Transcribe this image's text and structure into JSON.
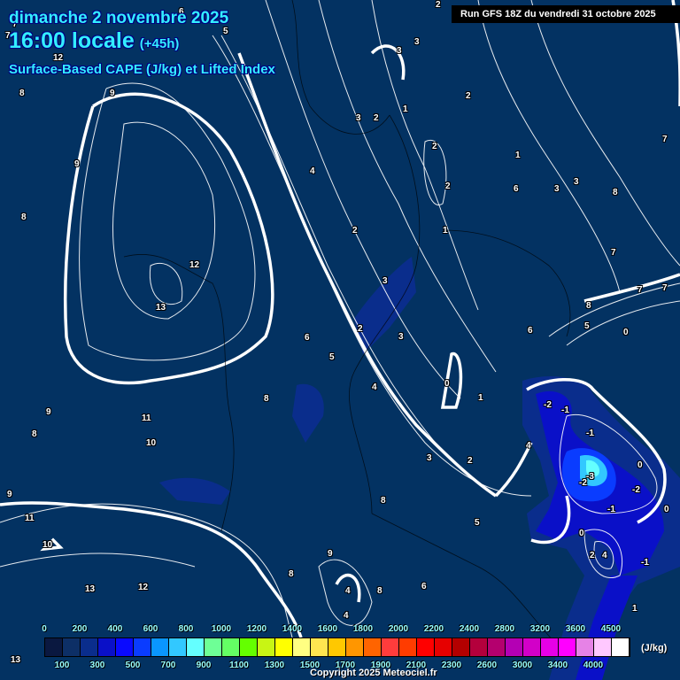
{
  "header": {
    "date": "dimanche 2 novembre 2025",
    "time": "16:00 locale",
    "lead": "(+45h)",
    "title": "Surface-Based CAPE (J/kg) et Lifted Index",
    "run": "Run GFS 18Z du vendredi 31 octobre 2025"
  },
  "legend": {
    "unit": "(J/kg)",
    "top_labels": [
      "0",
      "200",
      "400",
      "600",
      "800",
      "1000",
      "1200",
      "1400",
      "1600",
      "1800",
      "2000",
      "2200",
      "2400",
      "2800",
      "3200",
      "3600",
      "4500"
    ],
    "bottom_labels": [
      "100",
      "300",
      "500",
      "700",
      "900",
      "1100",
      "1300",
      "1500",
      "1700",
      "1900",
      "2100",
      "2300",
      "2600",
      "3000",
      "3400",
      "4000"
    ],
    "colors": [
      "#0a1840",
      "#0d2f66",
      "#0a2d8c",
      "#0a10c8",
      "#0a0aff",
      "#0a3cff",
      "#0a96ff",
      "#32c8ff",
      "#64ffff",
      "#6eff96",
      "#64ff64",
      "#64ff00",
      "#c8f514",
      "#ffff00",
      "#ffff82",
      "#ffe650",
      "#ffc800",
      "#ff9600",
      "#ff6400",
      "#ff3c3c",
      "#ff3c00",
      "#ff0000",
      "#e60000",
      "#b40000",
      "#b4003c",
      "#b4006e",
      "#b400b4",
      "#d200c8",
      "#e600e6",
      "#ff00ff",
      "#e682e6",
      "#ffc8ff",
      "#ffffff"
    ]
  },
  "lifted_index_labels": [
    "7",
    "12",
    "8",
    "9",
    "9",
    "8",
    "12",
    "13",
    "9",
    "8",
    "11",
    "10",
    "9",
    "8",
    "11",
    "10",
    "13",
    "12",
    "6",
    "5",
    "6",
    "3",
    "2",
    "1",
    "3",
    "2",
    "4",
    "2",
    "2",
    "1",
    "2",
    "2",
    "3",
    "3",
    "4",
    "5",
    "6",
    "7",
    "7",
    "7",
    "8",
    "7",
    "0",
    "2",
    "3",
    "3",
    "1",
    "0",
    "1",
    "-2",
    "-1",
    "-1",
    "-3",
    "-2",
    "0",
    "-2",
    "-1",
    "0",
    "0",
    "2",
    "4",
    "-1",
    "1",
    "4",
    "4",
    "3",
    "2",
    "8",
    "8",
    "6",
    "5",
    "9",
    "8",
    "13",
    "4",
    "5",
    "7",
    "6",
    "4",
    "3",
    "8"
  ],
  "copyright": "Copyright 2025 Meteociel.fr"
}
